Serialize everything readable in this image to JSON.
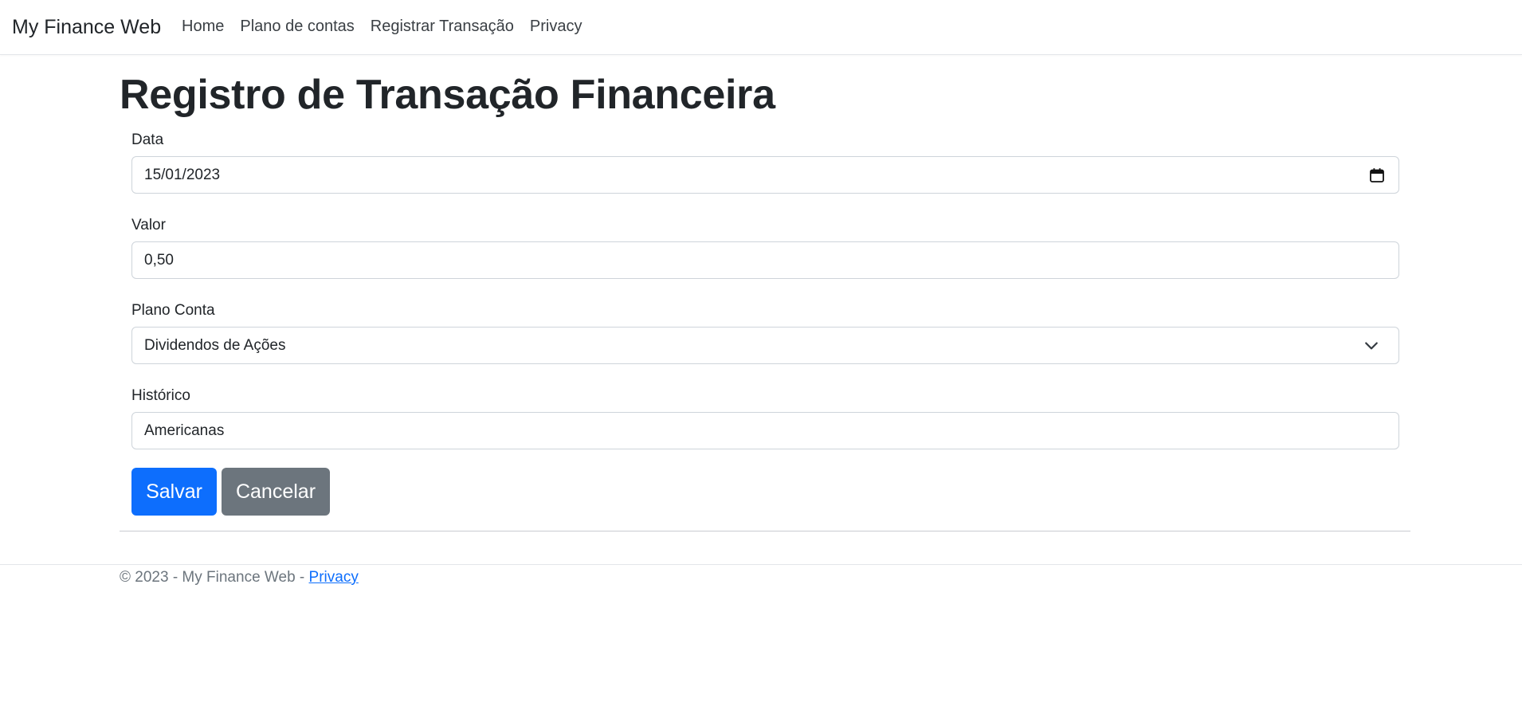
{
  "navbar": {
    "brand": "My Finance Web",
    "links": [
      "Home",
      "Plano de contas",
      "Registrar Transação",
      "Privacy"
    ]
  },
  "page": {
    "title": "Registro de Transação Financeira"
  },
  "form": {
    "data": {
      "label": "Data",
      "value": "15/01/2023",
      "icon": "calendar-icon"
    },
    "valor": {
      "label": "Valor",
      "value": "0,50"
    },
    "plano_conta": {
      "label": "Plano Conta",
      "value": "Dividendos de Ações",
      "icon": "chevron-down-icon"
    },
    "historico": {
      "label": "Histórico",
      "value": "Americanas"
    },
    "save_label": "Salvar",
    "cancel_label": "Cancelar"
  },
  "footer": {
    "text": "© 2023 - My Finance Web - ",
    "link": "Privacy"
  },
  "colors": {
    "primary": "#0d6efd",
    "secondary": "#6c757d",
    "text": "#212529"
  }
}
